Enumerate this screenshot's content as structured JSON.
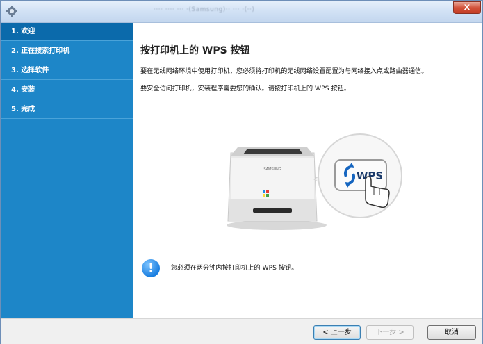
{
  "window": {
    "title": "···· ···· ··· ·(Samsung)·· ··· ·(··)",
    "close_label": "x"
  },
  "sidebar": {
    "items": [
      {
        "label": "1. 欢迎"
      },
      {
        "label": "2. 正在搜索打印机"
      },
      {
        "label": "3. 选择软件"
      },
      {
        "label": "4. 安装"
      },
      {
        "label": "5. 完成"
      }
    ]
  },
  "main": {
    "heading": "按打印机上的 WPS 按钮",
    "paragraph1": "要在无线网络环境中使用打印机，您必须将打印机的无线网络设置配置为与网络接入点或路由器通信。",
    "paragraph2": "要安全访问打印机，安装程序需要您的确认。请按打印机上的 WPS 按钮。",
    "printer_brand": "SAMSUNG",
    "wps_button_label": "WPS",
    "notice_icon": "!",
    "notice_text": "您必须在两分钟内按打印机上的 WPS 按钮。"
  },
  "footer": {
    "back_label": "< 上一步",
    "next_label": "下一步 >",
    "cancel_label": "取消"
  },
  "colors": {
    "sidebar_bg": "#1d86c8",
    "sidebar_active": "#0b6aab",
    "notice_icon": "#1b7fe0"
  }
}
